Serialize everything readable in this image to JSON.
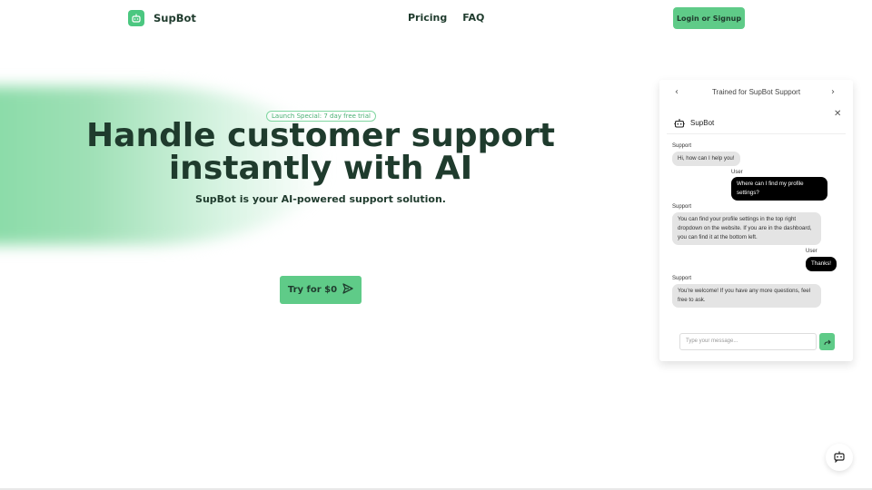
{
  "header": {
    "brand": "SupBot",
    "nav": [
      {
        "label": "Pricing"
      },
      {
        "label": "FAQ"
      }
    ],
    "login_label": "Login or Signup"
  },
  "hero": {
    "badge": "Launch Special: 7 day free trial",
    "title_line1": "Handle customer support",
    "title_line2": "instantly with AI",
    "subtitle": "SupBot is your AI-powered support solution.",
    "cta_label": "Try for $0"
  },
  "chat": {
    "top_title": "Trained for SupBot Support",
    "bot_name": "SupBot",
    "messages": [
      {
        "sender": "Support",
        "text": "Hi, how can I help you!"
      },
      {
        "sender": "User",
        "text": "Where can I find my profile settings?"
      },
      {
        "sender": "Support",
        "text": "You can find your profile settings in the top right dropdown on the website. If you are in the dashboard, you can find it at the bottom left."
      },
      {
        "sender": "User",
        "text": "Thanks!"
      },
      {
        "sender": "Support",
        "text": "You're welcome! If you have any more questions, feel free to ask."
      }
    ],
    "input_placeholder": "Type your message..."
  },
  "colors": {
    "brand_green": "#5fcb88",
    "text_dark": "#1f3b2d"
  }
}
